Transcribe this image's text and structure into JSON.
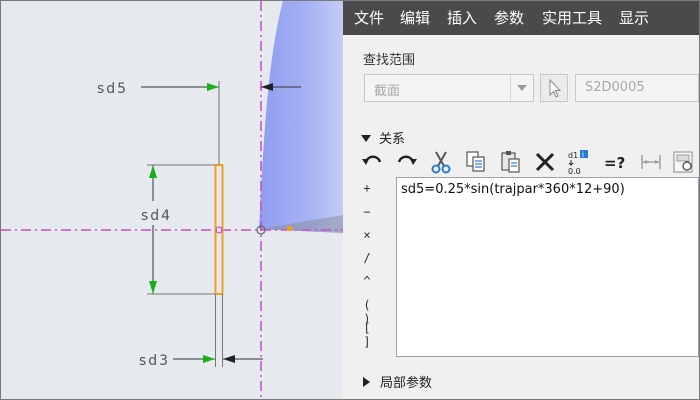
{
  "canvas": {
    "dimensions": [
      {
        "id": "sd5",
        "label": "sd5"
      },
      {
        "id": "sd4",
        "label": "sd4"
      },
      {
        "id": "sd3",
        "label": "sd3"
      }
    ]
  },
  "menu": {
    "items": [
      "文件",
      "编辑",
      "插入",
      "参数",
      "实用工具",
      "显示"
    ]
  },
  "scope": {
    "label": "查找范围",
    "type_value": "截面",
    "entity_value": "S2D0005"
  },
  "relations": {
    "title": "关系",
    "toolbar": [
      "undo-icon",
      "redo-icon",
      "cut-icon",
      "copy-icon",
      "paste-icon",
      "delete-icon",
      "switch-dimensions-icon",
      "evaluate-icon",
      "measure-icon",
      "sort-icon"
    ],
    "operators": [
      "+",
      "−",
      "×",
      "/",
      "^",
      "( )",
      "[ ]"
    ],
    "lines": [
      "sd5=0.25*sin(trajpar*360*12+90)"
    ]
  },
  "local_params": {
    "title": "局部参数"
  },
  "colors": {
    "menu_bg": "#4a4a4a",
    "centerline": "#c850c8",
    "section_orange": "#f0a020",
    "surface_blue": "#a7b3f3",
    "dimension_green": "#18b018"
  }
}
